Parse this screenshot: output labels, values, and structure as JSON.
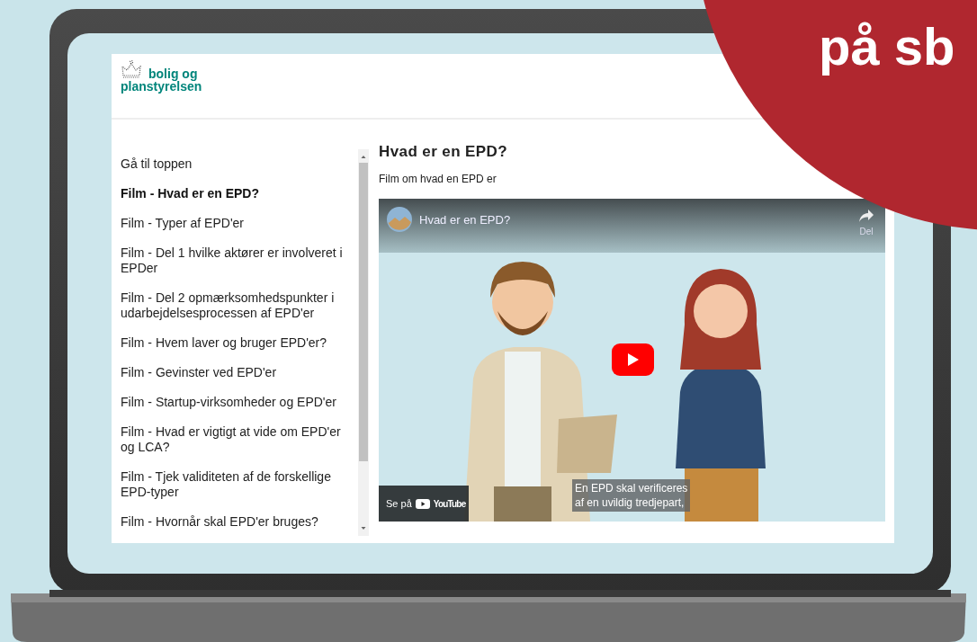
{
  "logo": {
    "lines": [
      "bolig og",
      "planstyrelsen"
    ]
  },
  "sidebar": {
    "items": [
      {
        "label": "Gå til toppen",
        "selected": false
      },
      {
        "label": "Film - Hvad er en EPD?",
        "selected": true
      },
      {
        "label": "Film - Typer af EPD'er",
        "selected": false
      },
      {
        "label": "Film - Del 1 hvilke aktører er involveret i EPDer",
        "selected": false
      },
      {
        "label": "Film - Del 2 opmærksomhedspunkter i udarbejdelsesprocessen af EPD'er",
        "selected": false
      },
      {
        "label": "Film - Hvem laver og bruger EPD'er?",
        "selected": false
      },
      {
        "label": "Film - Gevinster ved EPD'er",
        "selected": false
      },
      {
        "label": "Film - Startup-virksomheder og EPD'er",
        "selected": false
      },
      {
        "label": "Film - Hvad er vigtigt at vide om EPD'er og LCA?",
        "selected": false
      },
      {
        "label": "Film - Tjek validiteten af de forskellige EPD-typer",
        "selected": false
      },
      {
        "label": "Film - Hvornår skal EPD'er bruges?",
        "selected": false
      }
    ]
  },
  "content": {
    "heading": "Hvad er en EPD?",
    "description": "Film om hvad en EPD er",
    "video": {
      "title": "Hvad er en EPD?",
      "share_label": "Del",
      "watch_label": "Se på",
      "brand": "YouTube",
      "caption": [
        "En EPD skal verificeres",
        "af en uvildig tredjepart,"
      ]
    }
  },
  "overlay": {
    "text": "på sb"
  }
}
